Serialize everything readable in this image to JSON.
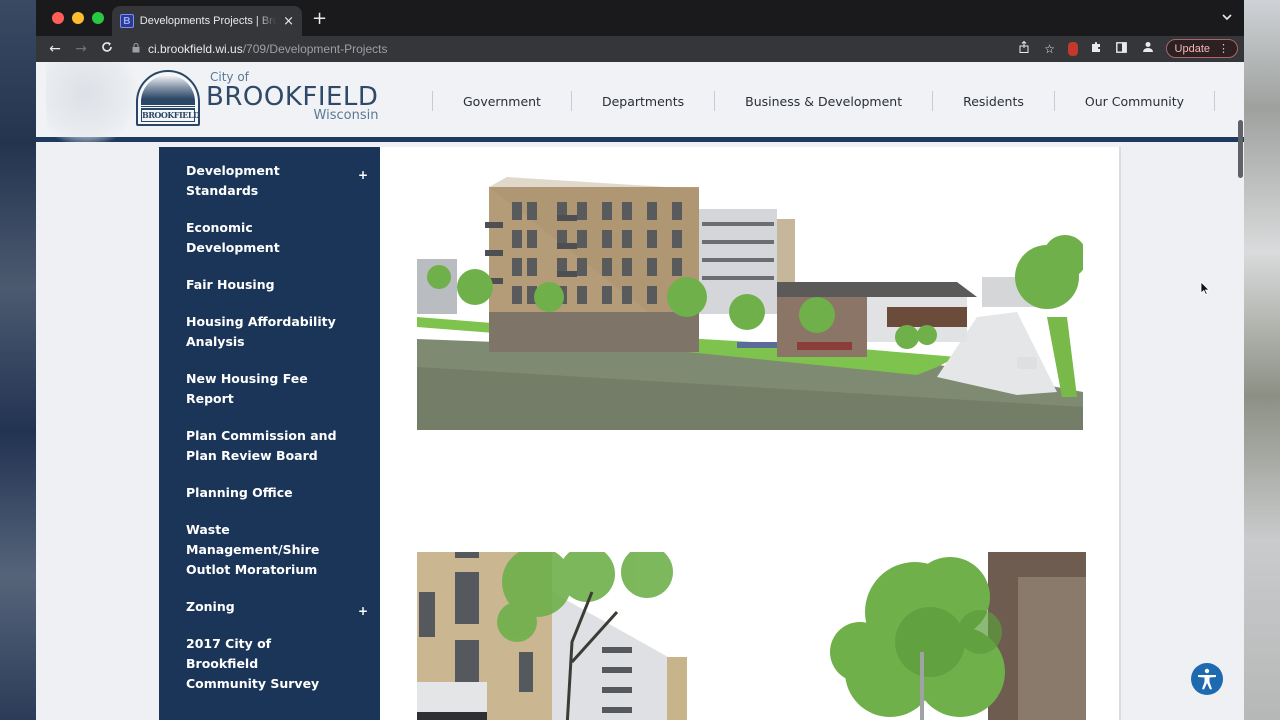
{
  "browser": {
    "tab": {
      "favicon": "B",
      "title": "Developments Projects | Brookfield, WI",
      "close_icon": "×"
    },
    "new_tab_icon": "+",
    "tab_dropdown_icon": "⌄",
    "nav": {
      "back": "←",
      "forward": "→",
      "reload": "C"
    },
    "url": {
      "host": "ci.brookfield.wi.us",
      "path": "/709/Development-Projects"
    },
    "toolbar_icons": [
      "share-icon",
      "bookmark-star-icon",
      "extension-red-icon",
      "extensions-puzzle-icon",
      "side-panel-icon",
      "profile-icon"
    ],
    "update_label": "Update",
    "menu_icon": "⋮"
  },
  "site": {
    "logo": {
      "seal_label": "BROOKFIELD",
      "city_of": "City of",
      "name": "BROOKFIELD",
      "state": "Wisconsin"
    },
    "nav": [
      {
        "label": "Government"
      },
      {
        "label": "Departments"
      },
      {
        "label": "Business & Development"
      },
      {
        "label": "Residents"
      },
      {
        "label": "Our Community"
      }
    ],
    "accent_color": "#1b3559",
    "sidebar": [
      {
        "label": "Development Standards",
        "expandable": true
      },
      {
        "label": "Economic Development",
        "expandable": false
      },
      {
        "label": "Fair Housing",
        "expandable": false
      },
      {
        "label": "Housing Affordability Analysis",
        "expandable": false
      },
      {
        "label": "New Housing Fee Report",
        "expandable": false
      },
      {
        "label": "Plan Commission and Plan Review Board",
        "expandable": false
      },
      {
        "label": "Planning Office",
        "expandable": false
      },
      {
        "label": "Waste Management/Shire Outlot Moratorium",
        "expandable": false
      },
      {
        "label": "Zoning",
        "expandable": true
      },
      {
        "label": "2017 City of Brookfield Community Survey",
        "expandable": false
      }
    ],
    "expand_icon": "+",
    "images": [
      {
        "description": "Architectural rendering of mixed-use apartment building with townhomes along street"
      },
      {
        "description": "Rendering of apartment building facade with tree"
      },
      {
        "description": "Rendering of tree beside brick building"
      }
    ]
  },
  "accessibility_button": "accessibility-icon"
}
